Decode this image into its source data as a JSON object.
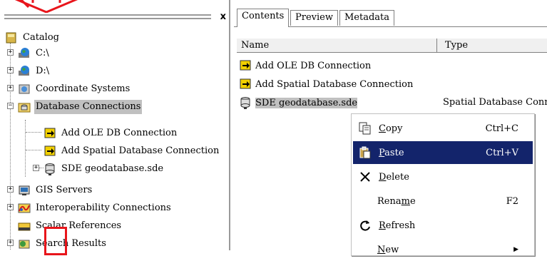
{
  "catalog": {
    "close_label": "x",
    "nodes": [
      {
        "label": "Catalog",
        "icon": "catalog-icon"
      },
      {
        "label": "C:\\",
        "icon": "drive-globe-icon"
      },
      {
        "label": "D:\\",
        "icon": "drive-globe-icon"
      },
      {
        "label": "Coordinate Systems",
        "icon": "coordinate-systems-icon"
      },
      {
        "label": "Database Connections",
        "icon": "database-connections-icon"
      },
      {
        "label": "Add OLE DB Connection",
        "icon": "add-connection-icon"
      },
      {
        "label": "Add Spatial Database Connection",
        "icon": "add-connection-icon"
      },
      {
        "label": "SDE geodatabase.sde",
        "icon": "sde-database-icon"
      },
      {
        "label": "GIS Servers",
        "icon": "gis-servers-icon"
      },
      {
        "label": "Interoperability Connections",
        "icon": "interoperability-icon"
      },
      {
        "label": "Scalar References",
        "icon": "scalar-references-icon"
      },
      {
        "label": "Search Results",
        "icon": "search-results-icon"
      }
    ]
  },
  "tabs": [
    "Contents",
    "Preview",
    "Metadata"
  ],
  "contents": {
    "columns": [
      "Name",
      "Type"
    ],
    "rows": [
      {
        "name": "Add OLE DB Connection",
        "type": ""
      },
      {
        "name": "Add Spatial Database Connection",
        "type": ""
      },
      {
        "name": "SDE geodatabase.sde",
        "type": "Spatial Database Conn"
      }
    ]
  },
  "context_menu": {
    "items": [
      {
        "pre": "",
        "key": "C",
        "post": "opy",
        "shortcut": "Ctrl+C",
        "icon": "copy-icon"
      },
      {
        "pre": "",
        "key": "P",
        "post": "aste",
        "shortcut": "Ctrl+V",
        "icon": "paste-icon"
      },
      {
        "pre": "",
        "key": "D",
        "post": "elete",
        "shortcut": "",
        "icon": "delete-icon"
      },
      {
        "pre": "Rena",
        "key": "m",
        "post": "e",
        "shortcut": "F2",
        "icon": ""
      },
      {
        "pre": "",
        "key": "R",
        "post": "efresh",
        "shortcut": "",
        "icon": "refresh-icon"
      },
      {
        "pre": "",
        "key": "N",
        "post": "ew",
        "shortcut": "",
        "icon": ""
      }
    ]
  },
  "colors": {
    "highlight": "#13246b",
    "annotation_red": "#e8151b",
    "selection_gray": "#c0c0c0"
  }
}
